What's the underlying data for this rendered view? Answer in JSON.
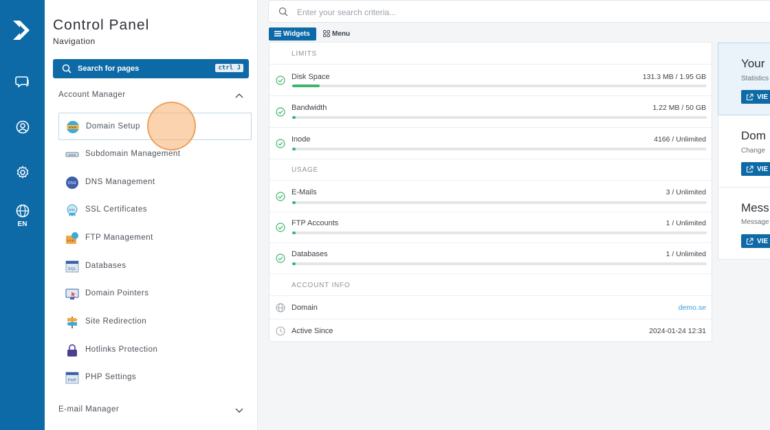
{
  "app": {
    "title": "Control Panel",
    "subtitle": "Navigation",
    "language": "EN",
    "accent_color": "#0d6aa6",
    "success_color": "#3fb56b"
  },
  "rail": {
    "icons": [
      "logo-icon",
      "chat-icon",
      "user-icon",
      "gear-icon",
      "globe-icon"
    ]
  },
  "nav_search": {
    "label": "Search for pages",
    "shortcut": "ctrl J"
  },
  "account_manager": {
    "label": "Account Manager",
    "expanded": true,
    "items": [
      {
        "label": "Domain Setup",
        "icon": "domain-setup-icon",
        "active": true
      },
      {
        "label": "Subdomain Management",
        "icon": "subdomain-icon"
      },
      {
        "label": "DNS Management",
        "icon": "dns-icon"
      },
      {
        "label": "SSL Certificates",
        "icon": "ssl-icon"
      },
      {
        "label": "FTP Management",
        "icon": "ftp-icon"
      },
      {
        "label": "Databases",
        "icon": "database-icon"
      },
      {
        "label": "Domain Pointers",
        "icon": "domain-pointer-icon"
      },
      {
        "label": "Site Redirection",
        "icon": "signpost-icon"
      },
      {
        "label": "Hotlinks Protection",
        "icon": "lock-icon"
      },
      {
        "label": "PHP Settings",
        "icon": "php-icon"
      }
    ]
  },
  "email_manager": {
    "label": "E-mail Manager",
    "expanded": false
  },
  "top_search": {
    "placeholder": "Enter your search criteria..."
  },
  "view_toggle": {
    "widgets": "Widgets",
    "menu": "Menu",
    "selected": "Widgets"
  },
  "stats": {
    "limits_label": "LIMITS",
    "usage_label": "USAGE",
    "account_info_label": "ACCOUNT INFO",
    "limits": [
      {
        "label": "Disk Space",
        "value": "131.3 MB / 1.95 GB",
        "progress": 0.067
      },
      {
        "label": "Bandwidth",
        "value": "1.22 MB / 50 GB",
        "progress": 0.005
      },
      {
        "label": "Inode",
        "value": "4166 / Unlimited",
        "progress": 0.005
      }
    ],
    "usage": [
      {
        "label": "E-Mails",
        "value": "3 / Unlimited",
        "progress": 0.005
      },
      {
        "label": "FTP Accounts",
        "value": "1 / Unlimited",
        "progress": 0.005
      },
      {
        "label": "Databases",
        "value": "1 / Unlimited",
        "progress": 0.005
      }
    ],
    "account_info": [
      {
        "label": "Domain",
        "value": "demo.se",
        "icon": "globe-icon"
      },
      {
        "label": "Active Since",
        "value": "2024-01-24 12:31",
        "icon": "clock-icon"
      }
    ]
  },
  "right_cards": [
    {
      "title": "Your",
      "subtitle": "Statistics",
      "button": "VIE",
      "highlighted": true
    },
    {
      "title": "Dom",
      "subtitle": "Change",
      "button": "VIE"
    },
    {
      "title": "Mess",
      "subtitle": "Message",
      "button": "VIE"
    }
  ]
}
